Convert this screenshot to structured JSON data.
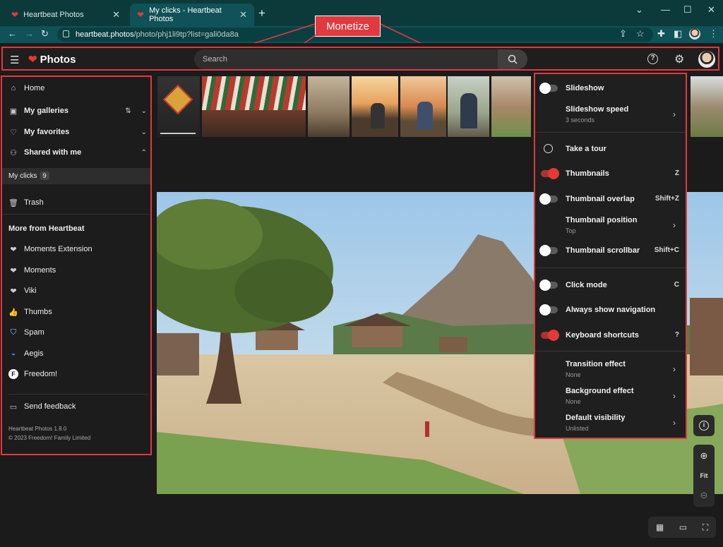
{
  "browser": {
    "tabs": [
      {
        "title": "Heartbeat Photos",
        "active": false
      },
      {
        "title": "My clicks - Heartbeat Photos",
        "active": true
      }
    ],
    "url_host": "heartbeat.photos",
    "url_path": "/photo/phj1li9tp?list=gali0da8a"
  },
  "annotation": {
    "label": "Monetize",
    "color": "#e0393e"
  },
  "header": {
    "logo": "Photos",
    "search_placeholder": "Search"
  },
  "sidebar": {
    "items": [
      {
        "label": "Home",
        "icon": "home-icon"
      },
      {
        "label": "My galleries",
        "icon": "gallery-icon"
      },
      {
        "label": "My favorites",
        "icon": "heart-outline-icon"
      },
      {
        "label": "Shared with me",
        "icon": "shared-icon"
      }
    ],
    "my_clicks": {
      "label": "My clicks",
      "count": "9"
    },
    "trash": "Trash",
    "more_title": "More from Heartbeat",
    "more": [
      {
        "label": "Moments Extension",
        "icon": "heart-icon"
      },
      {
        "label": "Moments",
        "icon": "heart-icon"
      },
      {
        "label": "Viki",
        "icon": "heart-icon"
      },
      {
        "label": "Thumbs",
        "icon": "thumb-icon"
      },
      {
        "label": "Spam",
        "icon": "spam-icon"
      },
      {
        "label": "Aegis",
        "icon": "aegis-icon"
      },
      {
        "label": "Freedom!",
        "icon": "freedom-icon"
      }
    ],
    "feedback": "Send feedback",
    "version": "Heartbeat Photos 1.8.0",
    "copyright": "© 2023 Freedom! Family Limited"
  },
  "settings": {
    "slideshow": {
      "label": "Slideshow",
      "on": false
    },
    "slideshow_speed": {
      "label": "Slideshow speed",
      "value": "3 seconds"
    },
    "tour": "Take a tour",
    "thumbnails": {
      "label": "Thumbnails",
      "key": "Z",
      "on": true
    },
    "thumbnail_overlap": {
      "label": "Thumbnail overlap",
      "key": "Shift+Z",
      "on": false
    },
    "thumbnail_position": {
      "label": "Thumbnail position",
      "value": "Top"
    },
    "thumbnail_scrollbar": {
      "label": "Thumbnail scrollbar",
      "key": "Shift+C",
      "on": false
    },
    "click_mode": {
      "label": "Click mode",
      "key": "C",
      "on": false
    },
    "always_nav": {
      "label": "Always show navigation",
      "on": false
    },
    "keyboard": {
      "label": "Keyboard shortcuts",
      "key": "?",
      "on": true
    },
    "transition": {
      "label": "Transition effect",
      "value": "None"
    },
    "background": {
      "label": "Background effect",
      "value": "None"
    },
    "visibility": {
      "label": "Default visibility",
      "value": "Unlisted"
    }
  },
  "controls": {
    "fit": "Fit"
  }
}
